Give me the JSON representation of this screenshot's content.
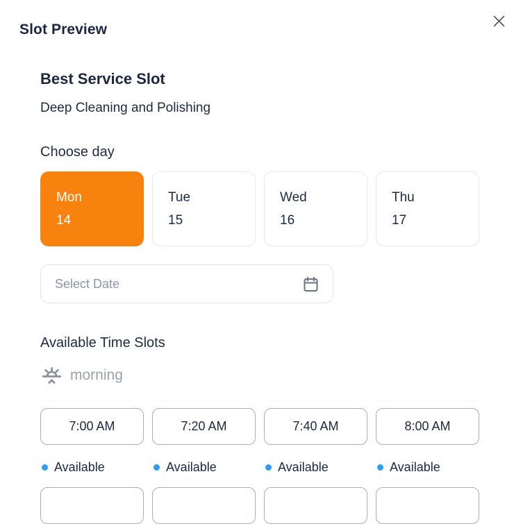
{
  "modal": {
    "title": "Slot Preview"
  },
  "service": {
    "name": "Best Service Slot",
    "description": "Deep Cleaning and Polishing"
  },
  "choose_day": {
    "label": "Choose day",
    "days": [
      {
        "day": "Mon",
        "date": "14",
        "selected": true
      },
      {
        "day": "Tue",
        "date": "15",
        "selected": false
      },
      {
        "day": "Wed",
        "date": "16",
        "selected": false
      },
      {
        "day": "Thu",
        "date": "17",
        "selected": false
      }
    ]
  },
  "date_picker": {
    "placeholder": "Select Date",
    "icon": "calendar-icon"
  },
  "time_slots": {
    "heading": "Available Time Slots",
    "period": {
      "icon": "sunrise-icon",
      "label": "morning"
    },
    "slots": [
      {
        "time": "7:00 AM",
        "status": "Available"
      },
      {
        "time": "7:20 AM",
        "status": "Available"
      },
      {
        "time": "7:40 AM",
        "status": "Available"
      },
      {
        "time": "8:00 AM",
        "status": "Available"
      }
    ],
    "partial_next_row": [
      "",
      "",
      "",
      ""
    ]
  },
  "colors": {
    "accent_orange": "#F7820D",
    "status_dot_blue": "#2D9CF4",
    "text_navy": "#1B2742",
    "muted_gray": "#9AA1AC"
  }
}
